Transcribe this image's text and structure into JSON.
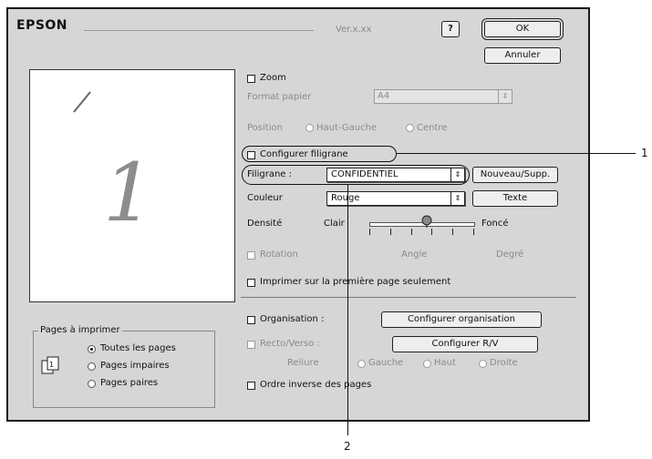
{
  "window": {
    "brand": "EPSON",
    "version": "Ver.x.xx",
    "help_label": "?",
    "ok_label": "OK",
    "cancel_label": "Annuler"
  },
  "preview": {
    "page_number": "1"
  },
  "print_pages": {
    "title": "Pages à imprimer",
    "options": [
      "Toutes les pages",
      "Pages impaires",
      "Pages paires"
    ],
    "selected_index": 0
  },
  "zoom": {
    "label": "Zoom",
    "paper_size_label": "Format papier",
    "paper_size_value": "A4",
    "position_label": "Position",
    "position_options": [
      "Haut-Gauche",
      "Centre"
    ]
  },
  "watermark": {
    "configure_label": "Configurer filigrane",
    "filigrane_label": "Filigrane :",
    "filigrane_value": "CONFIDENTIEL",
    "new_custom_button": "Nouveau/Supp.",
    "color_label": "Couleur",
    "color_value": "Rouge",
    "text_button": "Texte",
    "density_label": "Densité",
    "density_min": "Clair",
    "density_max": "Foncé",
    "density_level": 0.55,
    "rotation_label": "Rotation",
    "angle_label": "Angle",
    "degree_label": "Degré",
    "first_page_only": "Imprimer sur la première page seulement"
  },
  "layout": {
    "organisation_label": "Organisation :",
    "configure_organisation_button": "Configurer organisation",
    "duplex_label": "Recto/Verso :",
    "configure_duplex_button": "Configurer R/V",
    "binding_label": "Reliure",
    "binding_options": [
      "Gauche",
      "Haut",
      "Droite"
    ],
    "reverse_order_label": "Ordre inverse des pages"
  },
  "callouts": [
    "1",
    "2"
  ]
}
